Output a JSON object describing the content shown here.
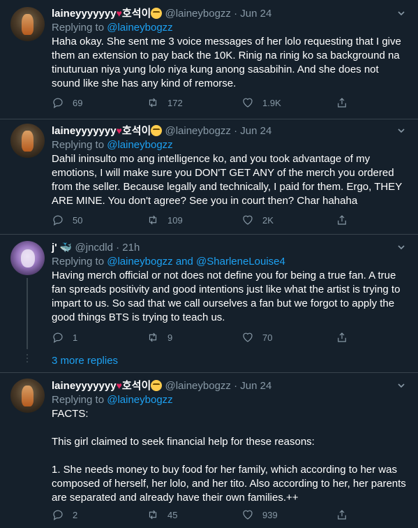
{
  "tweets": [
    {
      "name": "laineyyyyyyy",
      "name_suffix": "호석이",
      "handle": "@laineybogzz",
      "time": "Jun 24",
      "replying_prefix": "Replying to",
      "replying_to": [
        "@laineybogzz"
      ],
      "text": "Haha okay. She sent me 3 voice messages of her lolo requesting that I give\nthem an extension to pay back the 10K. Rinig na rinig ko sa background na\ntinuturuan niya yung lolo niya kung anong sasabihin. And she does not\nsound like she has any kind of remorse.",
      "replies": "69",
      "retweets": "172",
      "likes": "1.9K"
    },
    {
      "name": "laineyyyyyyy",
      "name_suffix": "호석이",
      "handle": "@laineybogzz",
      "time": "Jun 24",
      "replying_prefix": "Replying to",
      "replying_to": [
        "@laineybogzz"
      ],
      "text": "Dahil ininsulto mo ang intelligence ko, and you took advantage of my\nemotions, I will make sure you DON'T GET ANY of the merch you ordered\nfrom the seller. Because legally and technically, I paid for them. Ergo, THEY\nARE MINE. You don't agree? See you in court then? Char hahaha",
      "replies": "50",
      "retweets": "109",
      "likes": "2K"
    },
    {
      "name": "j'",
      "handle": "@jncdld",
      "time": "21h",
      "replying_prefix": "Replying to",
      "replying_to": [
        "@laineybogzz",
        "and",
        "@SharleneLouise4"
      ],
      "text": "Having merch official or not does not define you for being a true fan. A true\nfan spreads positivity and good intentions just like what the artist is trying to\nimpart to us. So sad that we call ourselves a fan but we forgot to apply the\ngood things BTS is trying to teach us.",
      "replies": "1",
      "retweets": "9",
      "likes": "70"
    },
    {
      "name": "laineyyyyyyy",
      "name_suffix": "호석이",
      "handle": "@laineybogzz",
      "time": "Jun 24",
      "replying_prefix": "Replying to",
      "replying_to": [
        "@laineybogzz"
      ],
      "text": "FACTS:\n\nThis girl claimed to seek financial help for these reasons:\n\n1. She needs money to buy food for her family, which according to her was\ncomposed of herself, her lolo, and her tito. Also according to her, her parents\nare separated and already have their own families.++",
      "replies": "2",
      "retweets": "45",
      "likes": "939"
    }
  ],
  "more_replies": "3 more replies",
  "separator": "·",
  "colors": {
    "background": "#15202b",
    "text": "#ffffff",
    "muted": "#8899a6",
    "link": "#1da1f2",
    "divider": "#38444d"
  }
}
